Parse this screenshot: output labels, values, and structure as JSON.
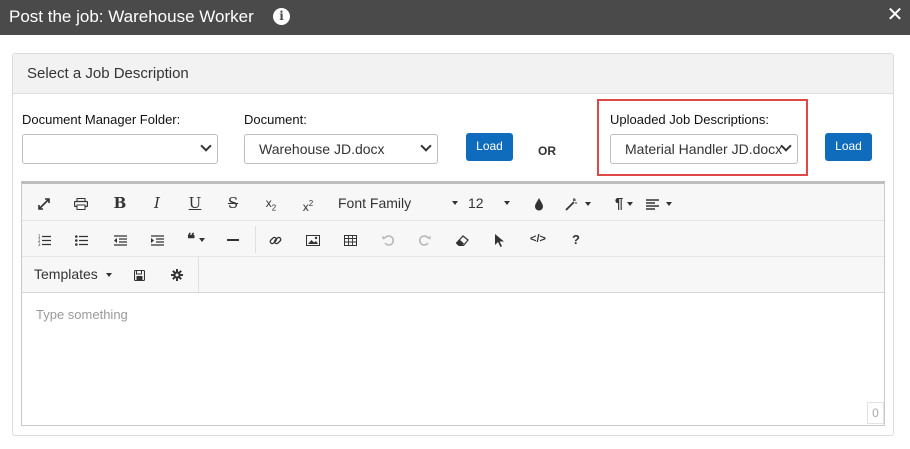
{
  "window": {
    "title": "Post the job: Warehouse Worker",
    "info_icon": "info-icon",
    "close_icon": "close-icon"
  },
  "panel": {
    "title": "Select a Job Description"
  },
  "fields": {
    "folder": {
      "label": "Document Manager Folder:",
      "value": ""
    },
    "document": {
      "label": "Document:",
      "value": "Warehouse JD.docx"
    },
    "uploaded": {
      "label": "Uploaded Job Descriptions:",
      "value": "Material Handler JD.docx"
    }
  },
  "buttons": {
    "load1": "Load",
    "load2": "Load"
  },
  "or_text": "OR",
  "toolbar": {
    "font_family": "Font Family",
    "font_size": "12",
    "templates": "Templates",
    "paragraph": "¶",
    "quote": "66"
  },
  "editor": {
    "placeholder": "Type something",
    "char_count": "0"
  },
  "colors": {
    "titlebar": "#4a4a4a",
    "accent": "#0f6cbd",
    "highlight": "#e04848"
  }
}
